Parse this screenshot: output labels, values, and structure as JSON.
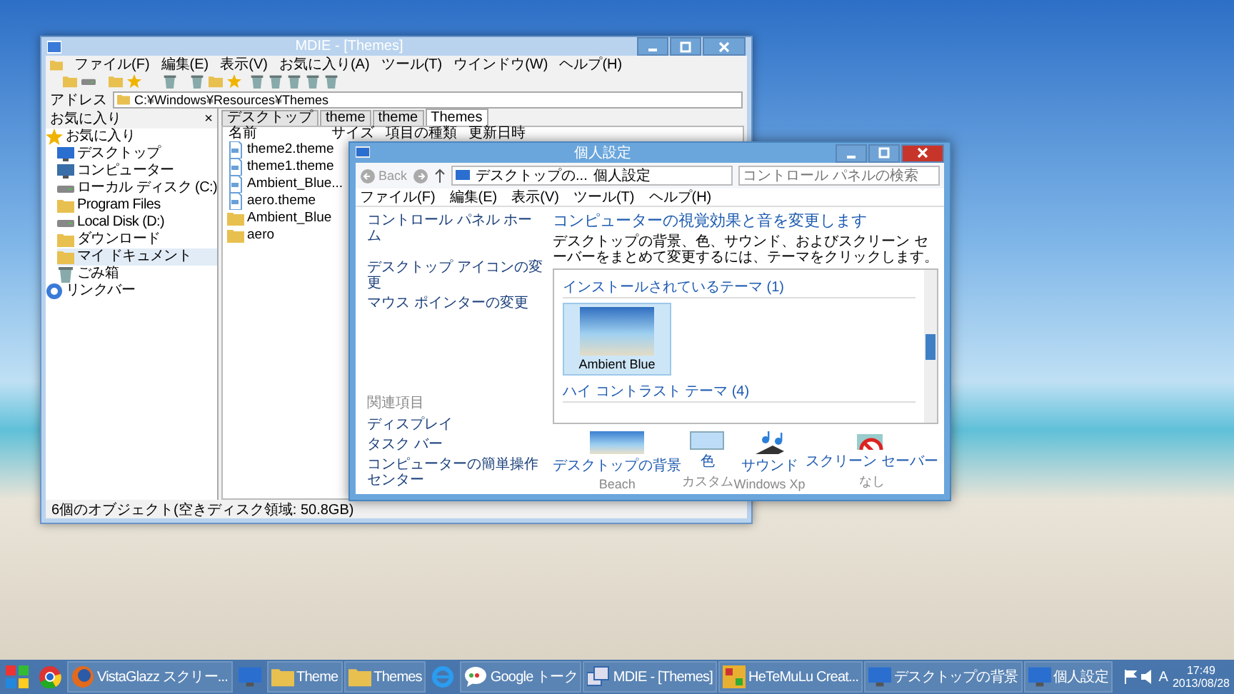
{
  "mdie": {
    "title": "MDIE - [Themes]",
    "menu": [
      "ファイル(F)",
      "編集(E)",
      "表示(V)",
      "お気に入り(A)",
      "ツール(T)",
      "ウインドウ(W)",
      "ヘルプ(H)"
    ],
    "address_label": "アドレス",
    "address": "C:¥Windows¥Resources¥Themes",
    "favorites_title": "お気に入り",
    "favorites_close": "×",
    "tree": [
      {
        "label": "お気に入り",
        "kind": "star",
        "selected": false,
        "children": [
          {
            "label": "デスクトップ",
            "kind": "desktop",
            "selected": false
          },
          {
            "label": "コンピューター",
            "kind": "computer",
            "selected": false
          },
          {
            "label": "ローカル ディスク (C:)",
            "kind": "drive",
            "selected": false
          },
          {
            "label": "Program Files",
            "kind": "folder",
            "selected": false
          },
          {
            "label": "Local Disk (D:)",
            "kind": "drive",
            "selected": false
          },
          {
            "label": "ダウンロード",
            "kind": "folder",
            "selected": false
          },
          {
            "label": "マイ ドキュメント",
            "kind": "folder",
            "selected": true
          },
          {
            "label": "ごみ箱",
            "kind": "trash",
            "selected": false
          }
        ]
      },
      {
        "label": "リンクバー",
        "kind": "link",
        "selected": false
      }
    ],
    "tabs": [
      {
        "label": "デスクトップ",
        "selected": false
      },
      {
        "label": "theme",
        "selected": false
      },
      {
        "label": "theme",
        "selected": false
      },
      {
        "label": "Themes",
        "selected": true
      }
    ],
    "columns": [
      "名前",
      "サイズ",
      "項目の種類",
      "更新日時"
    ],
    "files": [
      {
        "name": "theme2.theme",
        "kind": "file"
      },
      {
        "name": "theme1.theme",
        "kind": "file"
      },
      {
        "name": "Ambient_Blue...",
        "kind": "file"
      },
      {
        "name": "aero.theme",
        "kind": "file"
      },
      {
        "name": "Ambient_Blue",
        "kind": "folder"
      },
      {
        "name": "aero",
        "kind": "folder"
      }
    ],
    "status": "6個のオブジェクト(空きディスク領域: 50.8GB)"
  },
  "personalize": {
    "title": "個人設定",
    "back": "Back",
    "breadcrumb": [
      "デスクトップの...",
      "個人設定"
    ],
    "search": {
      "placeholder": "コントロール パネルの検索"
    },
    "menu": [
      "ファイル(F)",
      "編集(E)",
      "表示(V)",
      "ツール(T)",
      "ヘルプ(H)"
    ],
    "side_links": [
      "コントロール パネル ホーム",
      "デスクトップ アイコンの変更",
      "マウス ポインターの変更"
    ],
    "related_title": "関連項目",
    "related_links": [
      "ディスプレイ",
      "タスク バー",
      "コンピューターの簡単操作センター"
    ],
    "heading": "コンピューターの視覚効果と音を変更します",
    "description": "デスクトップの背景、色、サウンド、およびスクリーン セーバーをまとめて変更するには、テーマをクリックします。",
    "groups": [
      {
        "title": "インストールされているテーマ (1)",
        "themes": [
          {
            "name": "Ambient Blue",
            "selected": true
          }
        ]
      },
      {
        "title": "ハイ コントラスト テーマ (4)"
      }
    ],
    "settings": [
      {
        "kind": "wallpaper",
        "label": "デスクトップの背景",
        "value": "Beach"
      },
      {
        "kind": "color",
        "label": "色",
        "value": "カスタム"
      },
      {
        "kind": "sound",
        "label": "サウンド",
        "value": "Windows Xp"
      },
      {
        "kind": "screensaver",
        "label": "スクリーン セーバー",
        "value": "なし"
      }
    ]
  },
  "taskbar": {
    "items": [
      {
        "kind": "start"
      },
      {
        "kind": "chrome"
      },
      {
        "kind": "firefox",
        "label": "VistaGlazz スクリー..."
      },
      {
        "kind": "panel"
      },
      {
        "kind": "folder",
        "label": "Theme"
      },
      {
        "kind": "folder",
        "label": "Themes"
      },
      {
        "kind": "ie"
      },
      {
        "kind": "chat",
        "label": "Google トーク"
      },
      {
        "kind": "windows",
        "label": "MDIE - [Themes]"
      },
      {
        "kind": "app",
        "label": "HeTeMuLu Creat..."
      },
      {
        "kind": "monitor",
        "label": "デスクトップの背景"
      },
      {
        "kind": "monitor",
        "label": "個人設定"
      }
    ],
    "ime": "A",
    "time": "17:49",
    "date": "2013/08/28"
  }
}
